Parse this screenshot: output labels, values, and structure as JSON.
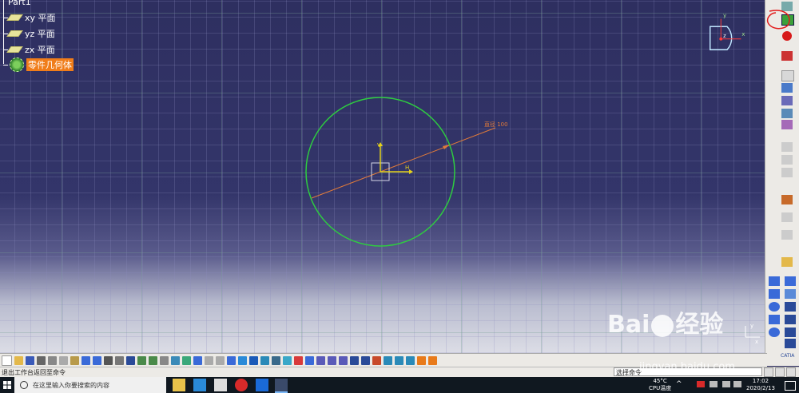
{
  "tree": {
    "root": "Part1",
    "nodes": [
      {
        "label": "xy 平面",
        "icon": "plane-icon"
      },
      {
        "label": "yz 平面",
        "icon": "plane-icon"
      },
      {
        "label": "zx 平面",
        "icon": "plane-icon"
      },
      {
        "label": "零件几何体",
        "icon": "part-body-icon",
        "selected": true
      }
    ]
  },
  "sketch": {
    "dimension_label": "直径 100",
    "axis_h_label": "H",
    "axis_v_label": "V",
    "circle_color": "#2ecc40",
    "dimension_color": "#e07a3a"
  },
  "compass": {
    "x_label": "x",
    "y_label": "y",
    "z_label": "z"
  },
  "mini_axis": {
    "x_label": "x",
    "y_label": "y"
  },
  "status_bar": {
    "left_text": "退出工作台返回至命令",
    "command_text": "选择命令"
  },
  "right_toolbar": {
    "catia_label": "CATIA"
  },
  "taskbar": {
    "search_placeholder": "在这里输入你要搜索的内容",
    "temp": "45°C",
    "temp_label": "CPU温度",
    "time": "17:02",
    "date": "2020/2/13"
  },
  "watermark": {
    "brand_left": "Bai",
    "brand_right": "经验",
    "site": "jingyan.baidu.com"
  }
}
